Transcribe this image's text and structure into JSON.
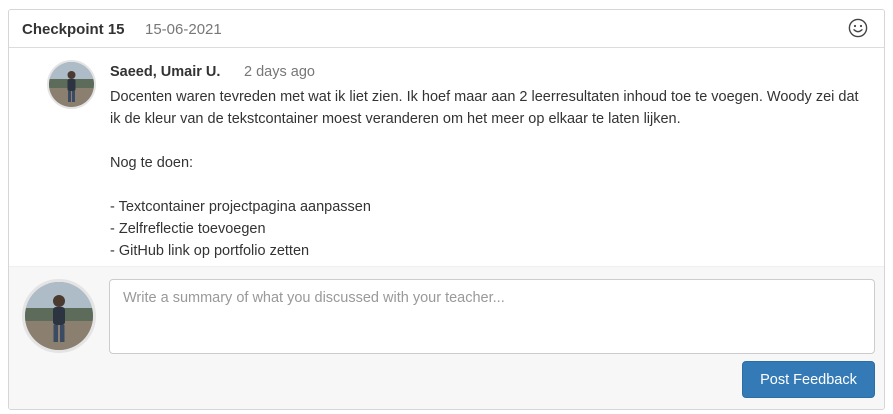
{
  "header": {
    "title": "Checkpoint 15",
    "date": "15-06-2021",
    "reaction_icon": "smiley-icon"
  },
  "comment": {
    "author": "Saeed, Umair U.",
    "time": "2 days ago",
    "paragraphs": [
      "Docenten waren tevreden met wat ik liet zien. Ik hoef maar aan 2 leerresultaten inhoud toe te voegen. Woody zei dat ik de kleur van de tekstcontainer moest veranderen om het meer op elkaar te laten lijken.",
      "",
      "Nog te doen:",
      "",
      "- Textcontainer projectpagina aanpassen",
      "- Zelfreflectie toevoegen",
      "- GitHub link op portfolio zetten"
    ]
  },
  "reply": {
    "placeholder": "Write a summary of what you discussed with your teacher...",
    "value": "",
    "post_label": "Post Feedback"
  },
  "colors": {
    "primary_button": "#337ab7",
    "muted_text": "#777777",
    "reply_background": "#f7f7f7"
  }
}
